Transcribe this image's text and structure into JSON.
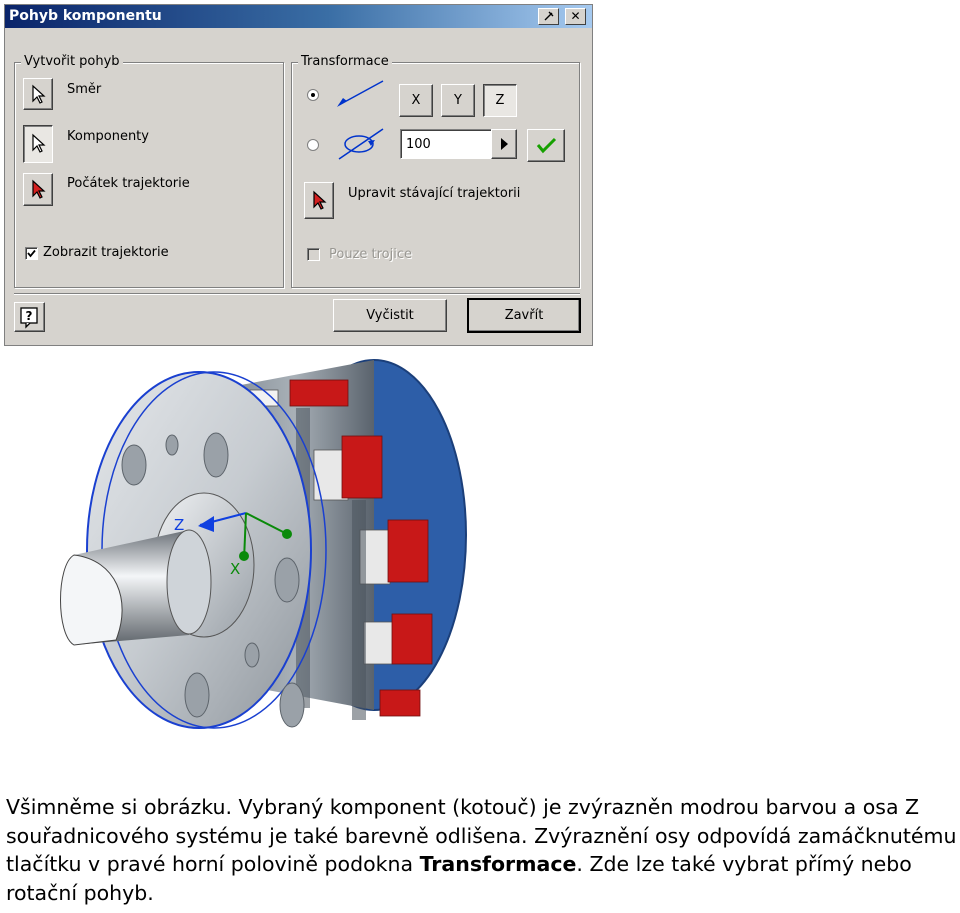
{
  "window": {
    "title": "Pohyb komponentu",
    "help_glyph": "?",
    "close_glyph": "✕",
    "pin_icon": "pin-icon"
  },
  "create_motion": {
    "group_label": "Vytvořit pohyb",
    "items": [
      {
        "label": "Směr",
        "icon": "pointer-arrow-icon"
      },
      {
        "label": "Komponenty",
        "icon": "pointer-arrow-icon"
      },
      {
        "label": "Počátek trajektorie",
        "icon": "pointer-arrow-red-icon"
      }
    ],
    "show_trajectory": {
      "label": "Zobrazit trajektorie",
      "checked": true
    }
  },
  "transform": {
    "group_label": "Transformace",
    "axis_buttons": [
      "X",
      "Y",
      "Z"
    ],
    "selected_axis": "Z",
    "linear_selected": true,
    "value": "100",
    "edit_label": "Upravit stávající trajektorii",
    "triples_only": {
      "label": "Pouze trojice",
      "checked": false,
      "enabled": false
    },
    "accent_color": "#0033cc",
    "confirm_color": "#16a000"
  },
  "footer": {
    "clear_label": "Vyčistit",
    "close_label": "Zavřít",
    "help_glyph": "?"
  },
  "viewport": {
    "axis_labels": {
      "z": "Z",
      "x": "X"
    },
    "axis_colors": {
      "z": "#1040e0",
      "x": "#0a8a0a",
      "highlight": "#1a40d0",
      "coil": "#c81818"
    }
  },
  "paragraph": {
    "text_1": "Všimněme si obrázku. Vybraný komponent (kotouč) je zvýrazněn modrou barvou a osa Z souřadnicového systému je také barevně odlišena. Zvýraznění osy odpovídá zamáčknutému tlačítku v pravé horní polovině podokna ",
    "bold": "Transformace",
    "text_2": ". Zde lze také vybrat přímý nebo rotační pohyb."
  }
}
